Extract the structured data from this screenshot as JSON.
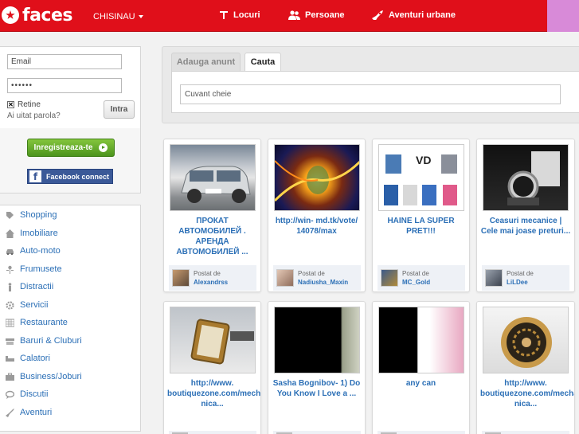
{
  "header": {
    "logo_text": "faces",
    "city": "CHISINAU",
    "nav": [
      {
        "label": "Locuri",
        "icon": "fork-knife-icon"
      },
      {
        "label": "Persoane",
        "icon": "people-icon"
      },
      {
        "label": "Aventuri urbane",
        "icon": "rocket-icon"
      }
    ]
  },
  "login": {
    "email_placeholder": "Email",
    "password_value": "••••••",
    "remember_label": "Retine",
    "forgot_label": "Ai uitat parola?",
    "submit_label": "Intra"
  },
  "register": {
    "register_label": "Inregistreaza-te",
    "facebook_label": "Facebook connect"
  },
  "categories": [
    {
      "label": "Shopping",
      "icon": "tag-icon"
    },
    {
      "label": "Imobiliare",
      "icon": "house-icon"
    },
    {
      "label": "Auto-moto",
      "icon": "car-icon"
    },
    {
      "label": "Frumusete",
      "icon": "flower-icon"
    },
    {
      "label": "Distractii",
      "icon": "figure-icon"
    },
    {
      "label": "Servicii",
      "icon": "gear-icon"
    },
    {
      "label": "Restaurante",
      "icon": "table-icon"
    },
    {
      "label": "Baruri & Cluburi",
      "icon": "bar-icon"
    },
    {
      "label": "Calatori",
      "icon": "bed-icon"
    },
    {
      "label": "Business/Joburi",
      "icon": "briefcase-icon"
    },
    {
      "label": "Discutii",
      "icon": "chat-icon"
    },
    {
      "label": "Aventuri",
      "icon": "rocket-icon"
    }
  ],
  "search": {
    "tab_add": "Adauga anunt",
    "tab_search": "Cauta",
    "keyword_placeholder": "Cuvant cheie"
  },
  "posted_label": "Postat de",
  "cards_row1": [
    {
      "title": "ПРОКАТ АВТОМОБИЛЕЙ . АРЕНДА АВТОМОБИЛЕЙ ...",
      "author": "Alexandrss",
      "thumb": "car"
    },
    {
      "title": "http://win- md.tk/vote/ 14078/max",
      "author": "Nadiusha_Maxin",
      "thumb": "fire"
    },
    {
      "title": "HAINE LA SUPER PRET!!!",
      "author": "MC_Gold",
      "thumb": "shirts"
    },
    {
      "title": "Ceasuri mecanice | Cele mai joase preturi...",
      "author": "LiLDee",
      "thumb": "watch"
    }
  ],
  "cards_row2": [
    {
      "title": "http://www. boutiquezone.com/mecha nica...",
      "thumb": "gold-watch"
    },
    {
      "title": "Sasha Bognibov- 1) Do You Know I Love a ...",
      "thumb": "black"
    },
    {
      "title": "any can",
      "thumb": "black-pink"
    },
    {
      "title": "http://www. boutiquezone.com/mecha nica...",
      "thumb": "skeleton-watch"
    }
  ],
  "colors": {
    "brand_red": "#e00f1a",
    "link_blue": "#2b6fb6",
    "register_green": "#4c941d",
    "facebook_blue": "#3b5998"
  }
}
